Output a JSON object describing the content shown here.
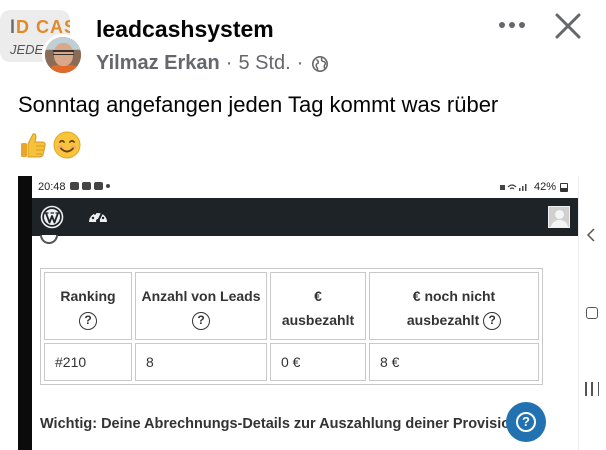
{
  "post": {
    "group_avatar": {
      "line1_accent": "D CAS",
      "line1_prefix": "l",
      "line2": "JEDE"
    },
    "group_name": "leadcashsystem",
    "author": "Yilmaz Erkan",
    "separator": "·",
    "time": "5 Std.",
    "privacy_icon": "globe-icon",
    "text": "Sonntag angefangen jeden Tag kommt was rüber",
    "emojis": [
      "thumbs-up-emoji",
      "smiling-face-emoji"
    ],
    "actions": {
      "more_icon": "more-dots-icon",
      "close_icon": "close-icon"
    }
  },
  "screenshot": {
    "status_bar": {
      "time": "20:48",
      "battery": "42%"
    },
    "admin_bar": {
      "icons": [
        "wordpress-logo-icon",
        "dashboard-icon",
        "profile-icon"
      ]
    },
    "table": {
      "headers": [
        {
          "line1": "Ranking",
          "line2": "?"
        },
        {
          "line1": "Anzahl von Leads",
          "line2": "?"
        },
        {
          "line1": "€",
          "line2": "ausbezahlt"
        },
        {
          "line1": "€ noch nicht",
          "line2": "ausbezahlt",
          "help": "?"
        }
      ],
      "rows": [
        [
          "#210",
          "8",
          "0 €",
          "8 €"
        ]
      ]
    },
    "notice": "Wichtig: Deine Abrechnungs-Details zur Auszahlung deiner Provisio",
    "help_button": "?",
    "nav": [
      "back-icon",
      "home-icon",
      "recent-apps-icon"
    ]
  },
  "colors": {
    "text": "#050505",
    "meta": "#65676b",
    "wp_bar": "#1d2327",
    "help_blue": "#2271b1"
  }
}
